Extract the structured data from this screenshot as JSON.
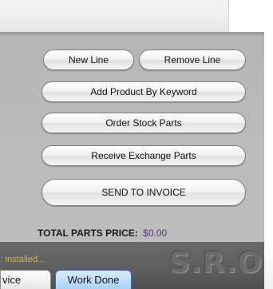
{
  "buttons": {
    "new_line": "New Line",
    "remove_line": "Remove Line",
    "add_product": "Add Product By Keyword",
    "order_stock": "Order Stock Parts",
    "receive_exchange": "Receive Exchange Parts",
    "send_to_invoice": "SEND TO INVOICE"
  },
  "totals": {
    "label": "TOTAL PARTS PRICE:",
    "value": "$0.00"
  },
  "status": {
    "installed_text": ": Installed..."
  },
  "logo": {
    "text": "S.R.O"
  },
  "tabs": [
    {
      "label": "vice",
      "active": false
    },
    {
      "label": "Work Done",
      "active": true
    }
  ],
  "colors": {
    "panel_bg": "#b9b9b9",
    "total_value": "#5a2d82",
    "installed_text": "#d8b24a",
    "active_tab": "#a9d2fb"
  }
}
